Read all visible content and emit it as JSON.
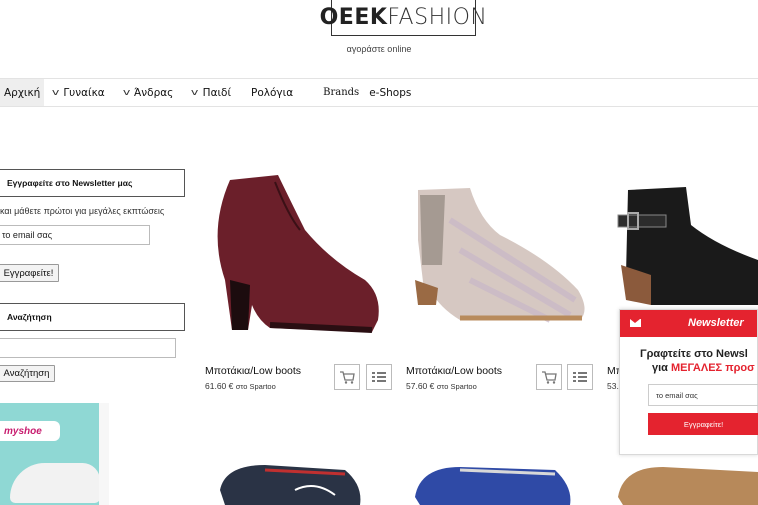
{
  "header": {
    "logo_bold": "OEEK",
    "logo_light": "FASHION",
    "tagline": "αγοράστε online"
  },
  "nav": {
    "items": [
      {
        "label": "Αρχική",
        "dropdown": false
      },
      {
        "label": "Γυναίκα",
        "dropdown": true
      },
      {
        "label": "Άνδρας",
        "dropdown": true
      },
      {
        "label": "Παιδί",
        "dropdown": true
      },
      {
        "label": "Ρολόγια",
        "dropdown": false
      },
      {
        "label": "Brands",
        "dropdown": false
      },
      {
        "label": "e-Shops",
        "dropdown": false
      }
    ]
  },
  "sidebar": {
    "newsletter_title": "Εγγραφείτε στο Newsletter μας",
    "newsletter_text": "και μάθετε πρώτοι για μεγάλες εκπτώσεις",
    "email_value": "το email σας",
    "subscribe_label": "Εγγραφείτε!",
    "search_title": "Αναζήτηση",
    "search_value": "",
    "search_button": "Αναζήτηση",
    "ad_logo": "myshoe"
  },
  "products": [
    {
      "title": "Μποτάκια/Low boots",
      "price": "61.60 €",
      "shop": "στο Spartoo",
      "color": "#6b1f2a"
    },
    {
      "title": "Μποτάκια/Low boots",
      "price": "57.60 €",
      "shop": "στο Spartoo",
      "color": "#c8b8c8"
    },
    {
      "title": "Μπ",
      "price": "53.",
      "shop": "",
      "color": "#1a1a1a"
    }
  ],
  "popup": {
    "title": "Newsletter",
    "line1": "Γραφτείτε στο Newsl",
    "line2_prefix": "για",
    "line2_red": "ΜΕΓΑΛΕΣ προσ",
    "email_value": "το email σας",
    "button": "Εγγραφείτε!"
  },
  "colors": {
    "accent": "#e4232f"
  }
}
